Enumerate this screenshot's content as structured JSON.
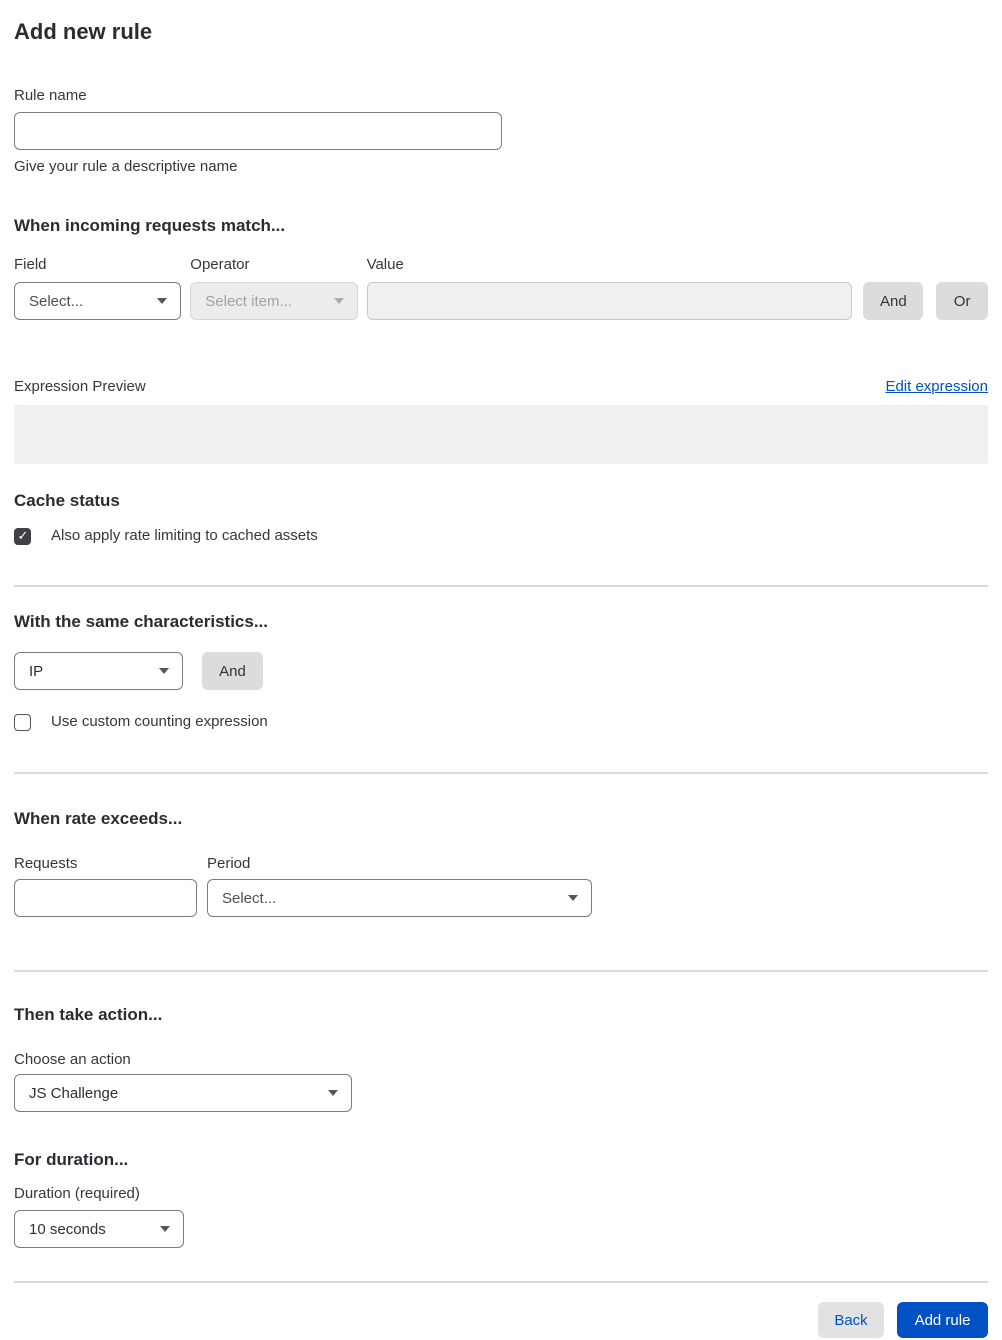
{
  "page": {
    "title": "Add new rule"
  },
  "rule_name": {
    "label": "Rule name",
    "value": "",
    "help": "Give your rule a descriptive name"
  },
  "match": {
    "heading": "When incoming requests match...",
    "field_label": "Field",
    "field_value": "Select...",
    "operator_label": "Operator",
    "operator_value": "Select item...",
    "value_label": "Value",
    "value_value": "",
    "and_label": "And",
    "or_label": "Or"
  },
  "expression": {
    "label": "Expression Preview",
    "edit_link": "Edit expression",
    "preview": ""
  },
  "cache": {
    "heading": "Cache status",
    "checkbox_label": "Also apply rate limiting to cached assets",
    "checked": true
  },
  "characteristics": {
    "heading": "With the same characteristics...",
    "select_value": "IP",
    "and_label": "And",
    "checkbox_label": "Use custom counting expression",
    "checked": false
  },
  "rate": {
    "heading": "When rate exceeds...",
    "requests_label": "Requests",
    "requests_value": "",
    "period_label": "Period",
    "period_value": "Select..."
  },
  "action": {
    "heading": "Then take action...",
    "label": "Choose an action",
    "value": "JS Challenge"
  },
  "duration": {
    "heading": "For duration...",
    "label": "Duration (required)",
    "value": "10 seconds"
  },
  "footer": {
    "back_label": "Back",
    "submit_label": "Add rule"
  },
  "colors": {
    "accent_blue": "#0051c3",
    "button_gray": "#dcdcdc",
    "checkbox_checked": "#404047",
    "divider": "#dadada",
    "disabled_bg": "#ececec"
  }
}
